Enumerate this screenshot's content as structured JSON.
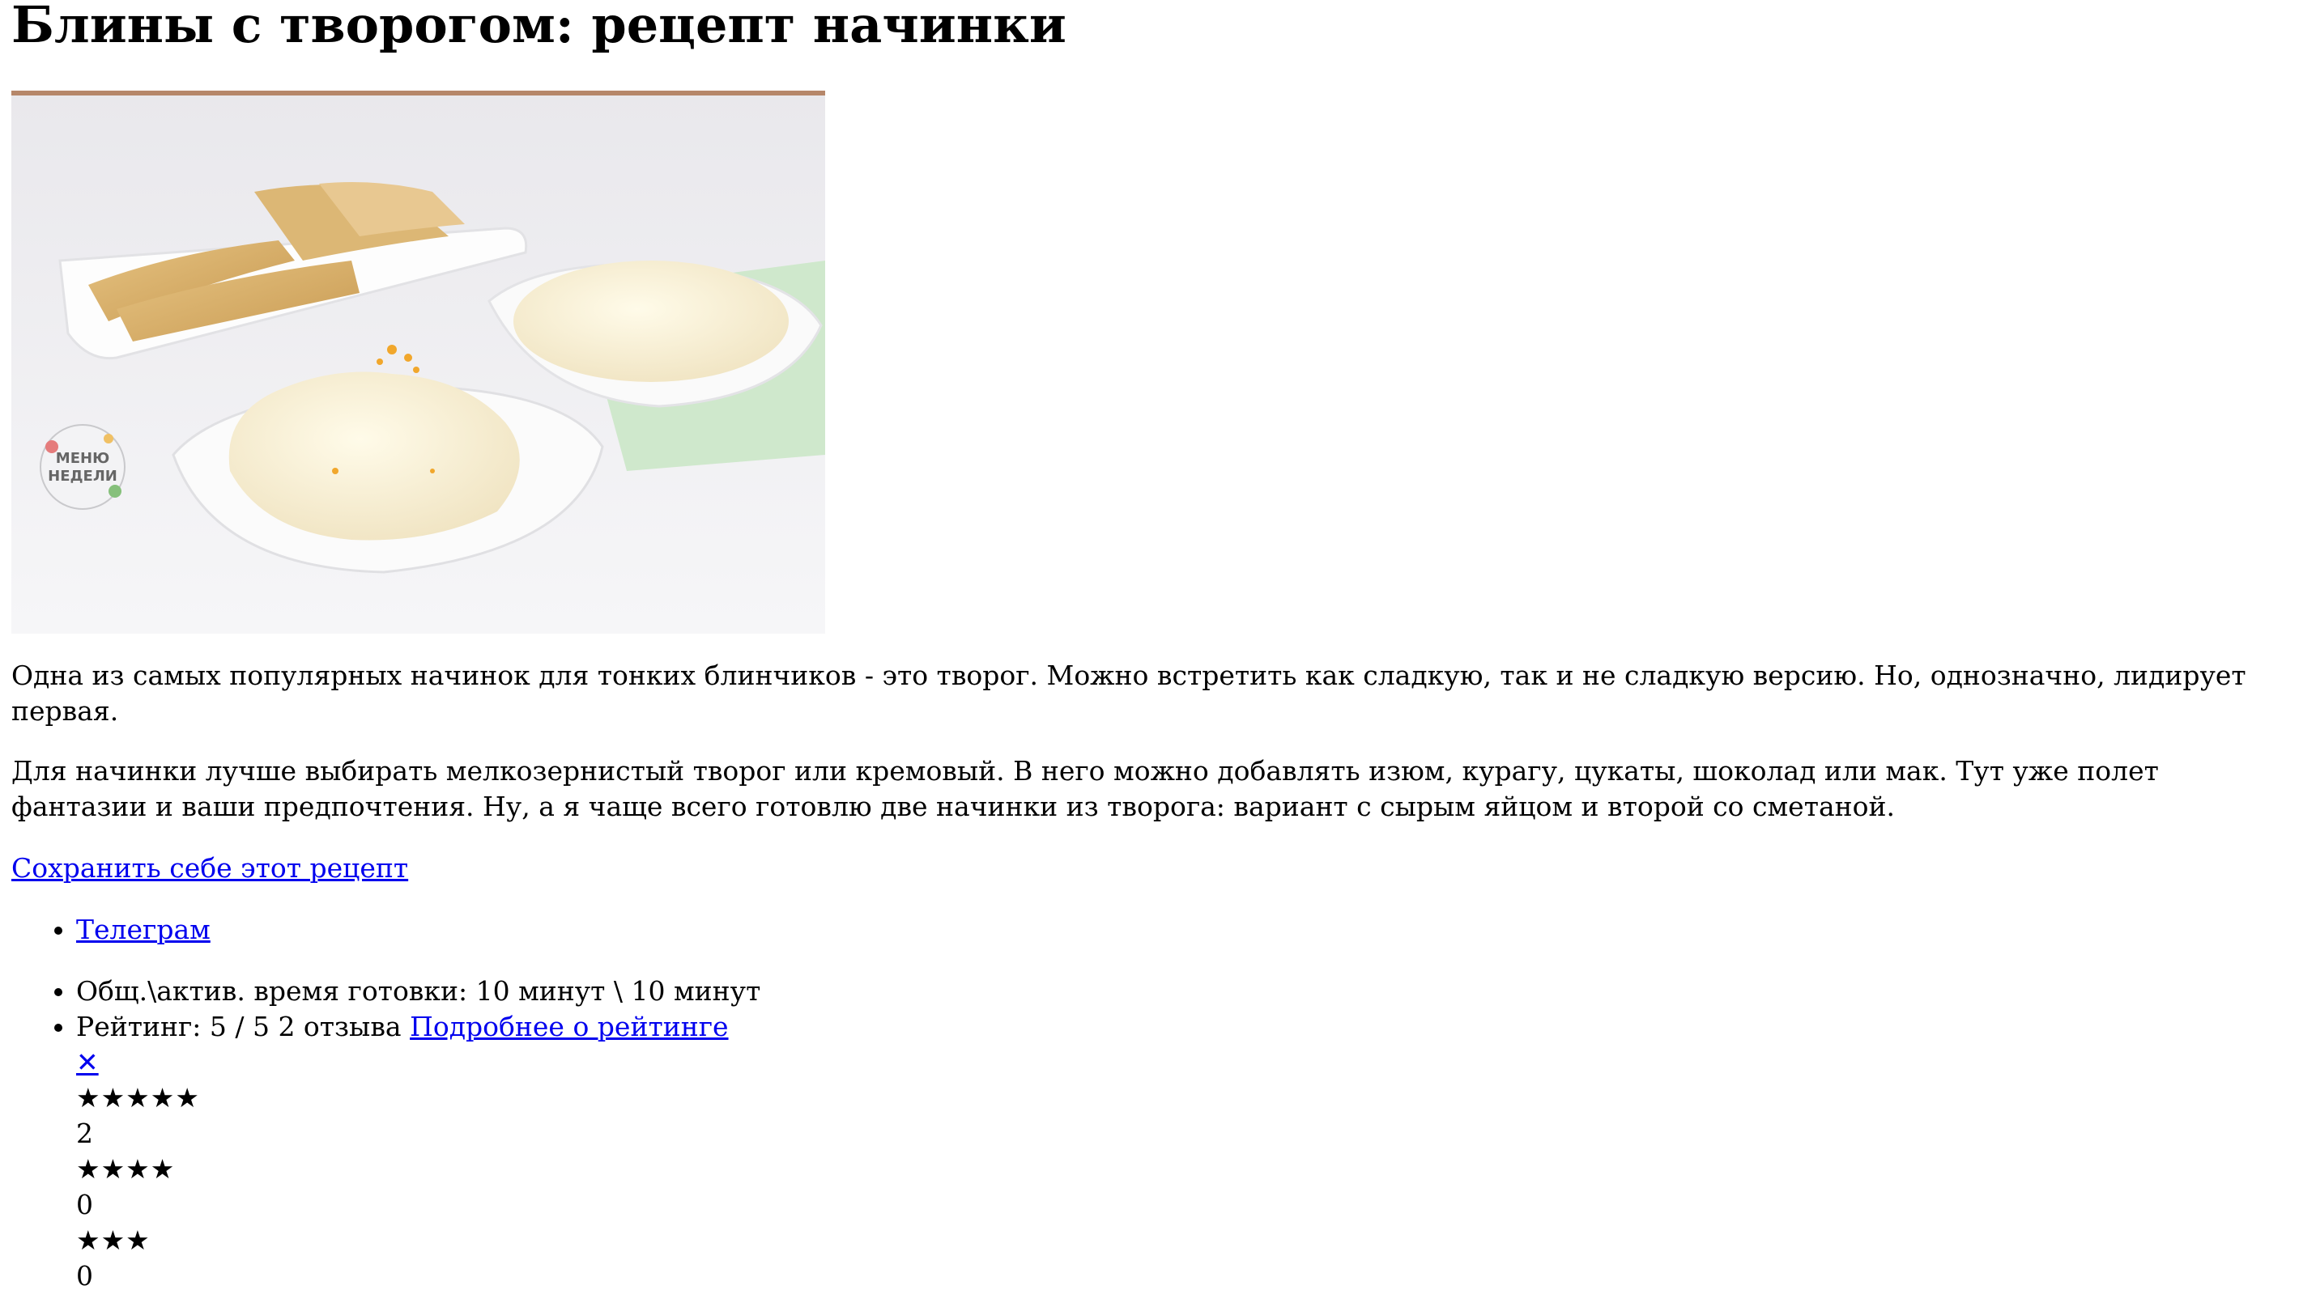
{
  "page": {
    "title": "Блины с творогом: рецепт начинки"
  },
  "hero_image": {
    "logo_text_line1": "МЕНЮ",
    "logo_text_line2": "НЕДЕЛИ"
  },
  "article": {
    "paragraph1": "Одна из самых популярных начинок для тонких блинчиков - это творог. Можно встретить как сладкую, так и не сладкую версию. Но, однозначно, лидирует первая.",
    "paragraph2": "Для начинки лучше выбирать мелкозернистый творог или кремовый. В него можно добавлять изюм, курагу, цукаты, шоколад или мак. Тут уже полет фантазии и ваши предпочтения. Ну, а я чаще всего готовлю две начинки из творога: вариант с сырым яйцом и второй со сметаной.",
    "save_link": "Сохранить себе этот рецепт"
  },
  "share": {
    "items": [
      {
        "label": "Телеграм"
      }
    ]
  },
  "meta": {
    "time_text": "Общ.\\актив. время готовки: 10 минут \\ 10 минут",
    "rating_prefix": "Рейтинг: 5 / 5 2 отзыва",
    "rating_link": "Подробнее о рейтинге",
    "close_symbol": "✕",
    "breakdown": [
      {
        "stars": "★★★★★",
        "count": "2"
      },
      {
        "stars": "★★★★",
        "count": "0"
      },
      {
        "stars": "★★★",
        "count": "0"
      }
    ]
  }
}
